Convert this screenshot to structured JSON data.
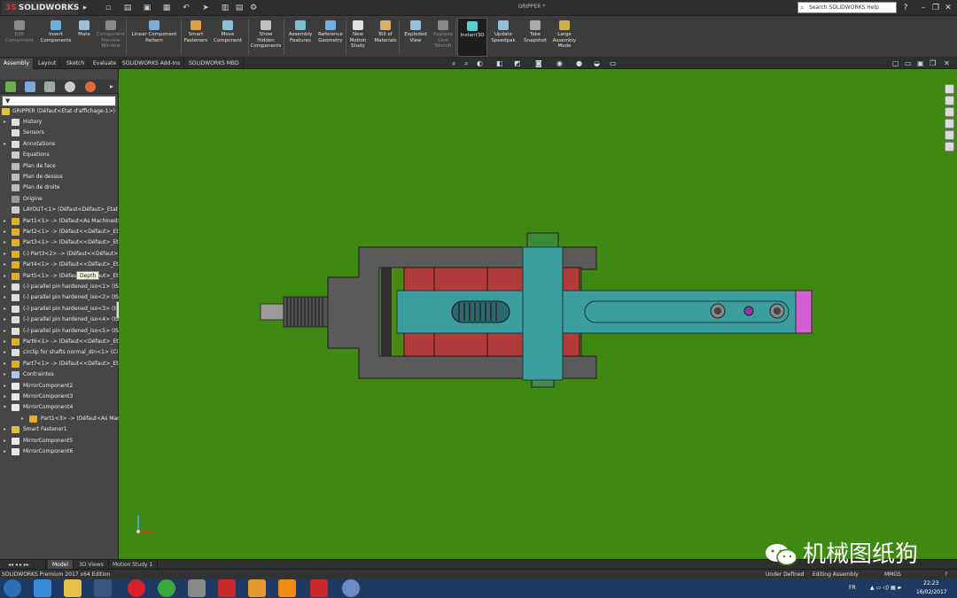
{
  "app": {
    "brand": "SOLIDWORKS",
    "brand_prefix": "3S",
    "document_title": "GRIPPER *"
  },
  "search": {
    "placeholder": "Search SOLIDWORKS Help"
  },
  "ribbon": [
    {
      "label": "Edit\nComponent",
      "icon": "edit-component-icon",
      "enabled": false
    },
    {
      "label": "Insert\nComponents",
      "icon": "insert-components-icon",
      "enabled": true
    },
    {
      "label": "Mate",
      "icon": "mate-icon",
      "enabled": true
    },
    {
      "label": "Component\nPreview\nWindow",
      "icon": "component-preview-icon",
      "enabled": false
    },
    {
      "label": "Linear Component\nPattern",
      "icon": "linear-pattern-icon",
      "enabled": true
    },
    {
      "label": "Smart\nFasteners",
      "icon": "smart-fasteners-icon",
      "enabled": true
    },
    {
      "label": "Move\nComponent",
      "icon": "move-component-icon",
      "enabled": true
    },
    {
      "label": "Show\nHidden\nComponents",
      "icon": "show-hidden-icon",
      "enabled": true
    },
    {
      "label": "Assembly\nFeatures",
      "icon": "assembly-features-icon",
      "enabled": true
    },
    {
      "label": "Reference\nGeometry",
      "icon": "reference-geometry-icon",
      "enabled": true
    },
    {
      "label": "New\nMotion\nStudy",
      "icon": "motion-study-icon",
      "enabled": true
    },
    {
      "label": "Bill of\nMaterials",
      "icon": "bom-icon",
      "enabled": true
    },
    {
      "label": "Exploded\nView",
      "icon": "exploded-view-icon",
      "enabled": true
    },
    {
      "label": "Explode\nLine\nSketch",
      "icon": "explode-line-icon",
      "enabled": false
    },
    {
      "label": "Instant3D",
      "icon": "instant3d-icon",
      "enabled": true
    },
    {
      "label": "Update\nSpeedpak",
      "icon": "speedpak-icon",
      "enabled": true
    },
    {
      "label": "Take\nSnapshot",
      "icon": "snapshot-icon",
      "enabled": true
    },
    {
      "label": "Large\nAssembly\nMode",
      "icon": "large-assembly-icon",
      "enabled": true
    }
  ],
  "command_tabs": [
    "Assembly",
    "Layout",
    "Sketch",
    "Evaluate",
    "SOLIDWORKS Add-Ins",
    "SOLIDWORKS MBD"
  ],
  "tree": {
    "filter_text": "▼",
    "root": "GRIPPER  (Défaut<Etat d'affichage-1>)",
    "tooltip": "Depth",
    "items": [
      {
        "label": "History",
        "expand": "▸",
        "icon": "history-icon",
        "level": 1
      },
      {
        "label": "Sensors",
        "expand": "",
        "icon": "sensors-icon",
        "level": 1
      },
      {
        "label": "Annotations",
        "expand": "▸",
        "icon": "annotations-icon",
        "level": 1
      },
      {
        "label": "Equations",
        "expand": "",
        "icon": "equations-icon",
        "level": 1
      },
      {
        "label": "Plan de face",
        "expand": "",
        "icon": "plane-icon",
        "level": 1
      },
      {
        "label": "Plan de dessus",
        "expand": "",
        "icon": "plane-icon",
        "level": 1
      },
      {
        "label": "Plan de droite",
        "expand": "",
        "icon": "plane-icon",
        "level": 1
      },
      {
        "label": "Origine",
        "expand": "",
        "icon": "origin-icon",
        "level": 1
      },
      {
        "label": "LAYOUT<1> (Défaut<Défaut>_Etat",
        "expand": "",
        "icon": "layout-icon",
        "level": 1
      },
      {
        "label": "Part1<1> -> (Défaut<As Machined>",
        "expand": "▸",
        "icon": "part-icon",
        "level": 1
      },
      {
        "label": "Part2<1> -> (Défaut<<Défaut>_Eta",
        "expand": "▸",
        "icon": "part-icon",
        "level": 1
      },
      {
        "label": "Part3<1> -> (Défaut<<Défaut>_Eta",
        "expand": "▸",
        "icon": "part-icon",
        "level": 1
      },
      {
        "label": "(-) Part3<2> -> (Défaut<<Défaut>_",
        "expand": "▸",
        "icon": "part-icon",
        "level": 1
      },
      {
        "label": "Part4<1> -> (Défaut<<Défaut>_Eta",
        "expand": "▸",
        "icon": "part-icon",
        "level": 1
      },
      {
        "label": "Part5<1> -> (Défaut<<Défaut>_Eta",
        "expand": "▸",
        "icon": "part-icon",
        "level": 1
      },
      {
        "label": "(-) parallel pin hardened_iso<1> (ISO",
        "expand": "▸",
        "icon": "pin-icon",
        "level": 1
      },
      {
        "label": "(-) parallel pin hardened_iso<2> (ISO",
        "expand": "▸",
        "icon": "pin-icon",
        "level": 1
      },
      {
        "label": "(-) parallel pin hardened_iso<3> (ISO",
        "expand": "▸",
        "icon": "pin-icon",
        "level": 1
      },
      {
        "label": "(-) parallel pin hardened_iso<4> (ISO",
        "expand": "▸",
        "icon": "pin-icon",
        "level": 1
      },
      {
        "label": "(-) parallel pin hardened_iso<5> (ISO",
        "expand": "▸",
        "icon": "pin-icon",
        "level": 1
      },
      {
        "label": "Part6<1> -> (Défaut<<Défaut>_Eta",
        "expand": "▸",
        "icon": "part-icon",
        "level": 1
      },
      {
        "label": "circlip for shafts normal_din<1> (Ci",
        "expand": "▸",
        "icon": "pin-icon",
        "level": 1
      },
      {
        "label": "Part7<1> -> (Défaut<<Défaut>_Eta",
        "expand": "▸",
        "icon": "part-icon",
        "level": 1
      },
      {
        "label": "Contraintes",
        "expand": "▸",
        "icon": "mates-icon",
        "level": 1
      },
      {
        "label": "MirrorComponent2",
        "expand": "▸",
        "icon": "mirror-icon",
        "level": 1
      },
      {
        "label": "MirrorComponent3",
        "expand": "▸",
        "icon": "mirror-icon",
        "level": 1
      },
      {
        "label": "MirrorComponent4",
        "expand": "▾",
        "icon": "mirror-icon",
        "level": 1
      },
      {
        "label": "Part1<3> -> (Défaut<As Machi",
        "expand": "▸",
        "icon": "part-icon",
        "level": 2
      },
      {
        "label": "Smart Fastener1",
        "expand": "▸",
        "icon": "fastener-icon",
        "level": 1
      },
      {
        "label": "MirrorComponent5",
        "expand": "▸",
        "icon": "mirror-icon",
        "level": 1
      },
      {
        "label": "MirrorComponent6",
        "expand": "▸",
        "icon": "mirror-icon",
        "level": 1
      }
    ]
  },
  "bottom_tabs": [
    "Model",
    "3D Views",
    "Motion Study 1"
  ],
  "status": {
    "edition": "SOLIDWORKS Premium 2017 x64 Edition",
    "definition": "Under Defined",
    "mode": "Editing Assembly",
    "units": "MMGS"
  },
  "taskbar": {
    "lang": "FR",
    "time": "22:23",
    "date": "16/02/2017"
  },
  "watermark": "机械图纸狗",
  "colors": {
    "viewport_bg": "#3f8811",
    "frame_gray": "#5a5a5a",
    "slider_teal": "#3d9ea0",
    "jaw_red": "#b13a3a",
    "tip_magenta": "#d060d0"
  }
}
